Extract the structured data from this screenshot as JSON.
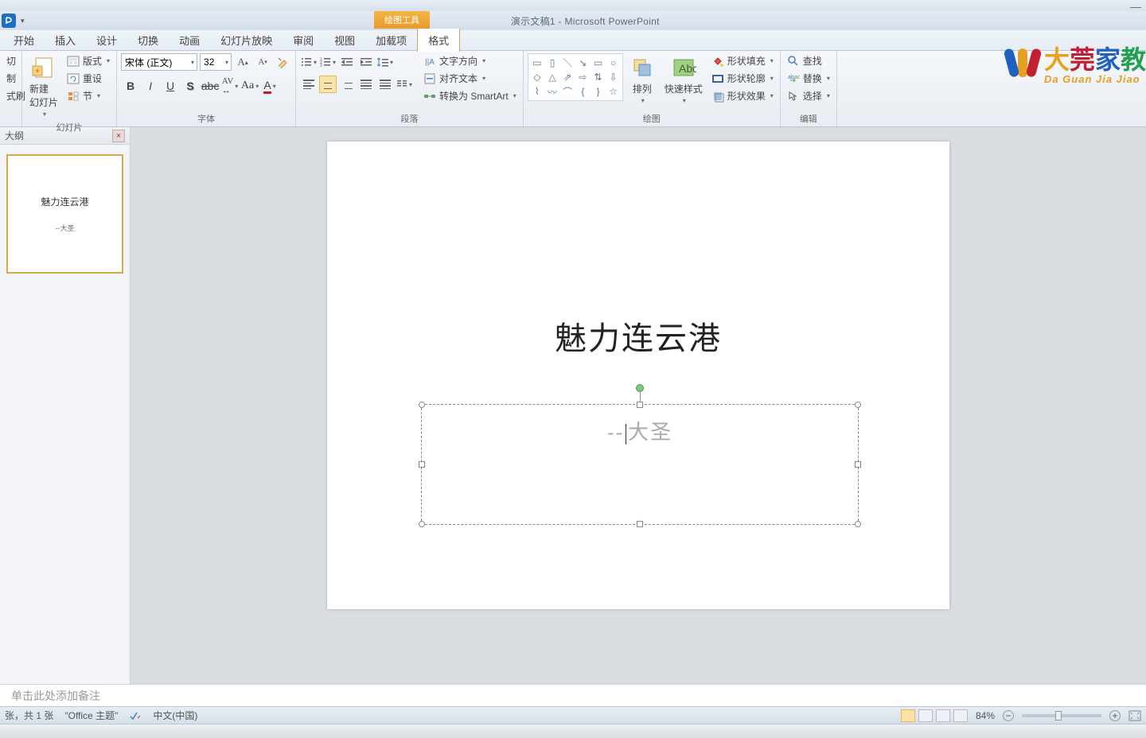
{
  "window": {
    "doc_title": "演示文稿1 - Microsoft PowerPoint",
    "context_tool": "绘图工具"
  },
  "tabs": {
    "home": "开始",
    "insert": "插入",
    "design": "设计",
    "transition": "切换",
    "animation": "动画",
    "slideshow": "幻灯片放映",
    "review": "审阅",
    "view": "视图",
    "addins": "加载项",
    "format": "格式"
  },
  "clipboard": {
    "copy": "制",
    "paste_brush": "式刷"
  },
  "slides_group": {
    "new_slide": "新建\n幻灯片",
    "layout": "版式",
    "reset": "重设",
    "section": "节",
    "label": "幻灯片"
  },
  "font": {
    "name": "宋体 (正文)",
    "size": "32",
    "label": "字体"
  },
  "paragraph": {
    "text_direction": "文字方向",
    "align_text": "对齐文本",
    "convert_smartart": "转换为 SmartArt",
    "label": "段落"
  },
  "drawing": {
    "arrange": "排列",
    "quick_styles": "快速样式",
    "shape_fill": "形状填充",
    "shape_outline": "形状轮廓",
    "shape_effects": "形状效果",
    "label": "绘图"
  },
  "editing": {
    "find": "查找",
    "replace": "替换",
    "select": "选择",
    "label": "编辑"
  },
  "outline": {
    "tab": "大纲",
    "thumb_title": "魅力连云港",
    "thumb_sub": "--大圣"
  },
  "slide": {
    "title": "魅力连云港",
    "subtitle": "--大圣"
  },
  "notes": {
    "placeholder": "单击此处添加备注"
  },
  "status": {
    "slide_count": "张，共 1 张",
    "theme": "\"Office 主题\"",
    "lang": "中文(中国)",
    "zoom": "84%"
  },
  "watermark": {
    "text": "大莞家教",
    "sub": "Da Guan Jia Jiao"
  }
}
